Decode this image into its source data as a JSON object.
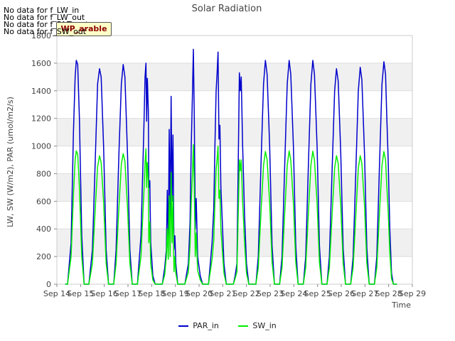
{
  "nodata_notes": [
    "No data for f_LW_in",
    "No data for f_LW_out",
    "No data for f_PAR_out",
    "No data for f_SW_out"
  ],
  "badge_label": "WP_arable",
  "chart_data": {
    "type": "line",
    "title": "Solar Radiation",
    "xlabel": "Time",
    "ylabel": "LW, SW (W/m2), PAR (umol/m2/s)",
    "xlim": [
      14,
      29
    ],
    "ylim": [
      0,
      1800
    ],
    "yticks": [
      0,
      200,
      400,
      600,
      800,
      1000,
      1200,
      1400,
      1600,
      1800
    ],
    "xticks": [
      14,
      15,
      16,
      17,
      18,
      19,
      20,
      21,
      22,
      23,
      24,
      25,
      26,
      27,
      28,
      29
    ],
    "xtick_labels": [
      "Sep 14",
      "Sep 15",
      "Sep 16",
      "Sep 17",
      "Sep 18",
      "Sep 19",
      "Sep 20",
      "Sep 21",
      "Sep 22",
      "Sep 23",
      "Sep 24",
      "Sep 25",
      "Sep 26",
      "Sep 27",
      "Sep 28",
      "Sep 29"
    ],
    "grid": true,
    "background_bands": true,
    "legend_position": "bottom-center",
    "series": [
      {
        "name": "PAR_in",
        "color": "#0000cc",
        "points": [
          [
            14.35,
            0
          ],
          [
            14.45,
            0
          ],
          [
            14.6,
            300
          ],
          [
            14.7,
            1100
          ],
          [
            14.77,
            1500
          ],
          [
            14.82,
            1620
          ],
          [
            14.88,
            1590
          ],
          [
            14.95,
            1200
          ],
          [
            15.05,
            350
          ],
          [
            15.15,
            0
          ],
          [
            15.35,
            0
          ],
          [
            15.5,
            250
          ],
          [
            15.62,
            900
          ],
          [
            15.72,
            1450
          ],
          [
            15.8,
            1560
          ],
          [
            15.87,
            1500
          ],
          [
            15.97,
            1000
          ],
          [
            16.08,
            250
          ],
          [
            16.18,
            0
          ],
          [
            16.4,
            0
          ],
          [
            16.5,
            250
          ],
          [
            16.62,
            950
          ],
          [
            16.72,
            1450
          ],
          [
            16.8,
            1590
          ],
          [
            16.87,
            1500
          ],
          [
            16.98,
            950
          ],
          [
            17.08,
            250
          ],
          [
            17.18,
            0
          ],
          [
            17.4,
            0
          ],
          [
            17.55,
            350
          ],
          [
            17.62,
            800
          ],
          [
            17.68,
            1200
          ],
          [
            17.72,
            1500
          ],
          [
            17.76,
            1600
          ],
          [
            17.79,
            1180
          ],
          [
            17.82,
            1490
          ],
          [
            17.86,
            1250
          ],
          [
            17.88,
            700
          ],
          [
            17.92,
            750
          ],
          [
            17.96,
            300
          ],
          [
            18.05,
            60
          ],
          [
            18.15,
            0
          ],
          [
            18.45,
            0
          ],
          [
            18.55,
            120
          ],
          [
            18.62,
            250
          ],
          [
            18.66,
            680
          ],
          [
            18.7,
            300
          ],
          [
            18.74,
            1120
          ],
          [
            18.78,
            450
          ],
          [
            18.82,
            1360
          ],
          [
            18.86,
            600
          ],
          [
            18.9,
            1080
          ],
          [
            18.94,
            250
          ],
          [
            18.98,
            350
          ],
          [
            19.02,
            150
          ],
          [
            19.1,
            0
          ],
          [
            19.4,
            0
          ],
          [
            19.55,
            150
          ],
          [
            19.62,
            450
          ],
          [
            19.67,
            1000
          ],
          [
            19.72,
            1380
          ],
          [
            19.76,
            1700
          ],
          [
            19.8,
            1200
          ],
          [
            19.84,
            400
          ],
          [
            19.88,
            620
          ],
          [
            19.94,
            200
          ],
          [
            20.05,
            60
          ],
          [
            20.15,
            0
          ],
          [
            20.4,
            0
          ],
          [
            20.55,
            300
          ],
          [
            20.62,
            550
          ],
          [
            20.67,
            1000
          ],
          [
            20.72,
            1400
          ],
          [
            20.76,
            1520
          ],
          [
            20.8,
            1680
          ],
          [
            20.84,
            1050
          ],
          [
            20.88,
            1150
          ],
          [
            20.92,
            700
          ],
          [
            20.98,
            450
          ],
          [
            21.05,
            150
          ],
          [
            21.15,
            0
          ],
          [
            21.45,
            0
          ],
          [
            21.52,
            60
          ],
          [
            21.6,
            150
          ],
          [
            21.66,
            950
          ],
          [
            21.7,
            1530
          ],
          [
            21.74,
            1400
          ],
          [
            21.78,
            1500
          ],
          [
            21.84,
            1000
          ],
          [
            21.92,
            500
          ],
          [
            22.0,
            150
          ],
          [
            22.1,
            0
          ],
          [
            22.4,
            0
          ],
          [
            22.5,
            200
          ],
          [
            22.62,
            900
          ],
          [
            22.72,
            1450
          ],
          [
            22.8,
            1620
          ],
          [
            22.87,
            1520
          ],
          [
            22.98,
            1000
          ],
          [
            23.08,
            280
          ],
          [
            23.18,
            0
          ],
          [
            23.4,
            0
          ],
          [
            23.5,
            200
          ],
          [
            23.62,
            900
          ],
          [
            23.72,
            1450
          ],
          [
            23.8,
            1620
          ],
          [
            23.87,
            1520
          ],
          [
            23.98,
            1000
          ],
          [
            24.08,
            280
          ],
          [
            24.18,
            0
          ],
          [
            24.4,
            0
          ],
          [
            24.5,
            200
          ],
          [
            24.62,
            900
          ],
          [
            24.72,
            1450
          ],
          [
            24.8,
            1620
          ],
          [
            24.87,
            1520
          ],
          [
            24.98,
            1000
          ],
          [
            25.08,
            280
          ],
          [
            25.18,
            0
          ],
          [
            25.4,
            0
          ],
          [
            25.5,
            200
          ],
          [
            25.62,
            850
          ],
          [
            25.72,
            1400
          ],
          [
            25.8,
            1560
          ],
          [
            25.87,
            1470
          ],
          [
            25.98,
            950
          ],
          [
            26.08,
            260
          ],
          [
            26.18,
            0
          ],
          [
            26.4,
            0
          ],
          [
            26.5,
            200
          ],
          [
            26.62,
            850
          ],
          [
            26.72,
            1400
          ],
          [
            26.8,
            1570
          ],
          [
            26.87,
            1480
          ],
          [
            26.98,
            950
          ],
          [
            27.08,
            260
          ],
          [
            27.18,
            0
          ],
          [
            27.4,
            0
          ],
          [
            27.5,
            200
          ],
          [
            27.62,
            900
          ],
          [
            27.72,
            1450
          ],
          [
            27.8,
            1610
          ],
          [
            27.87,
            1520
          ],
          [
            27.92,
            1220
          ],
          [
            27.98,
            900
          ],
          [
            28.05,
            400
          ],
          [
            28.12,
            80
          ],
          [
            28.2,
            0
          ],
          [
            28.35,
            0
          ]
        ]
      },
      {
        "name": "SW_in",
        "color": "#00ee00",
        "points": [
          [
            14.35,
            0
          ],
          [
            14.45,
            0
          ],
          [
            14.6,
            200
          ],
          [
            14.7,
            650
          ],
          [
            14.77,
            900
          ],
          [
            14.82,
            965
          ],
          [
            14.88,
            940
          ],
          [
            14.95,
            700
          ],
          [
            15.05,
            200
          ],
          [
            15.15,
            0
          ],
          [
            15.35,
            0
          ],
          [
            15.5,
            150
          ],
          [
            15.62,
            550
          ],
          [
            15.72,
            850
          ],
          [
            15.8,
            930
          ],
          [
            15.87,
            880
          ],
          [
            15.97,
            600
          ],
          [
            16.08,
            150
          ],
          [
            16.18,
            0
          ],
          [
            16.4,
            0
          ],
          [
            16.5,
            150
          ],
          [
            16.62,
            560
          ],
          [
            16.72,
            870
          ],
          [
            16.8,
            945
          ],
          [
            16.87,
            890
          ],
          [
            16.98,
            560
          ],
          [
            17.08,
            150
          ],
          [
            17.18,
            0
          ],
          [
            17.4,
            0
          ],
          [
            17.55,
            200
          ],
          [
            17.62,
            480
          ],
          [
            17.68,
            700
          ],
          [
            17.72,
            880
          ],
          [
            17.76,
            980
          ],
          [
            17.79,
            700
          ],
          [
            17.82,
            880
          ],
          [
            17.86,
            750
          ],
          [
            17.88,
            300
          ],
          [
            17.92,
            450
          ],
          [
            17.96,
            150
          ],
          [
            18.05,
            30
          ],
          [
            18.15,
            0
          ],
          [
            18.45,
            0
          ],
          [
            18.55,
            70
          ],
          [
            18.62,
            200
          ],
          [
            18.66,
            400
          ],
          [
            18.7,
            180
          ],
          [
            18.74,
            640
          ],
          [
            18.78,
            200
          ],
          [
            18.82,
            810
          ],
          [
            18.86,
            300
          ],
          [
            18.9,
            640
          ],
          [
            18.94,
            90
          ],
          [
            18.98,
            200
          ],
          [
            19.02,
            80
          ],
          [
            19.1,
            0
          ],
          [
            19.4,
            0
          ],
          [
            19.55,
            90
          ],
          [
            19.62,
            280
          ],
          [
            19.67,
            600
          ],
          [
            19.72,
            800
          ],
          [
            19.76,
            1010
          ],
          [
            19.8,
            700
          ],
          [
            19.84,
            200
          ],
          [
            19.88,
            370
          ],
          [
            19.94,
            100
          ],
          [
            20.05,
            30
          ],
          [
            20.15,
            0
          ],
          [
            20.4,
            0
          ],
          [
            20.55,
            180
          ],
          [
            20.62,
            320
          ],
          [
            20.67,
            600
          ],
          [
            20.72,
            830
          ],
          [
            20.76,
            900
          ],
          [
            20.8,
            1000
          ],
          [
            20.84,
            620
          ],
          [
            20.88,
            680
          ],
          [
            20.92,
            400
          ],
          [
            20.98,
            250
          ],
          [
            21.05,
            80
          ],
          [
            21.15,
            0
          ],
          [
            21.45,
            0
          ],
          [
            21.52,
            40
          ],
          [
            21.6,
            90
          ],
          [
            21.66,
            560
          ],
          [
            21.7,
            900
          ],
          [
            21.74,
            820
          ],
          [
            21.78,
            900
          ],
          [
            21.84,
            600
          ],
          [
            21.92,
            300
          ],
          [
            22.0,
            80
          ],
          [
            22.1,
            0
          ],
          [
            22.4,
            0
          ],
          [
            22.5,
            120
          ],
          [
            22.62,
            540
          ],
          [
            22.72,
            860
          ],
          [
            22.8,
            960
          ],
          [
            22.87,
            900
          ],
          [
            22.98,
            590
          ],
          [
            23.08,
            160
          ],
          [
            23.18,
            0
          ],
          [
            23.4,
            0
          ],
          [
            23.5,
            120
          ],
          [
            23.62,
            540
          ],
          [
            23.72,
            860
          ],
          [
            23.8,
            965
          ],
          [
            23.87,
            900
          ],
          [
            23.98,
            590
          ],
          [
            24.08,
            160
          ],
          [
            24.18,
            0
          ],
          [
            24.4,
            0
          ],
          [
            24.5,
            120
          ],
          [
            24.62,
            540
          ],
          [
            24.72,
            860
          ],
          [
            24.8,
            962
          ],
          [
            24.87,
            900
          ],
          [
            24.98,
            590
          ],
          [
            25.08,
            160
          ],
          [
            25.18,
            0
          ],
          [
            25.4,
            0
          ],
          [
            25.5,
            120
          ],
          [
            25.62,
            520
          ],
          [
            25.72,
            840
          ],
          [
            25.8,
            930
          ],
          [
            25.87,
            875
          ],
          [
            25.98,
            570
          ],
          [
            26.08,
            150
          ],
          [
            26.18,
            0
          ],
          [
            26.4,
            0
          ],
          [
            26.5,
            120
          ],
          [
            26.62,
            520
          ],
          [
            26.72,
            840
          ],
          [
            26.8,
            930
          ],
          [
            26.87,
            875
          ],
          [
            26.98,
            570
          ],
          [
            27.08,
            150
          ],
          [
            27.18,
            0
          ],
          [
            27.4,
            0
          ],
          [
            27.5,
            120
          ],
          [
            27.62,
            540
          ],
          [
            27.72,
            860
          ],
          [
            27.8,
            960
          ],
          [
            27.87,
            900
          ],
          [
            27.92,
            720
          ],
          [
            27.98,
            530
          ],
          [
            28.05,
            230
          ],
          [
            28.12,
            40
          ],
          [
            28.2,
            0
          ],
          [
            28.35,
            0
          ]
        ]
      }
    ]
  }
}
